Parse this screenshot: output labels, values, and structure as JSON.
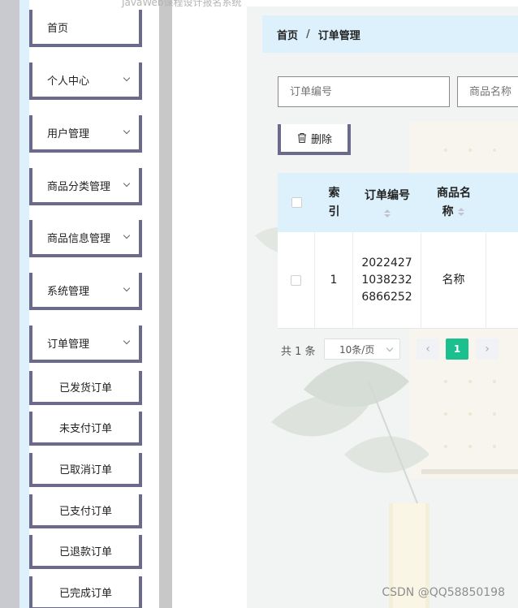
{
  "top_title": "JavaWeb课程设计报名系统",
  "sidebar": {
    "items": [
      {
        "label": "首页",
        "has_children": false
      },
      {
        "label": "个人中心",
        "has_children": true
      },
      {
        "label": "用户管理",
        "has_children": true
      },
      {
        "label": "商品分类管理",
        "has_children": true
      },
      {
        "label": "商品信息管理",
        "has_children": true
      },
      {
        "label": "系统管理",
        "has_children": true
      },
      {
        "label": "订单管理",
        "has_children": true
      }
    ],
    "sub_items": [
      {
        "label": "已发货订单"
      },
      {
        "label": "未支付订单"
      },
      {
        "label": "已取消订单"
      },
      {
        "label": "已支付订单"
      },
      {
        "label": "已退款订单"
      },
      {
        "label": "已完成订单"
      }
    ]
  },
  "breadcrumb": {
    "home": "首页",
    "separator": "/",
    "current": "订单管理"
  },
  "search": {
    "order_no_placeholder": "订单编号",
    "product_name_placeholder": "商品名称"
  },
  "toolbar": {
    "delete_label": "删除"
  },
  "table": {
    "headers": {
      "index": "索引",
      "order_no": "订单编号",
      "product_name": "商品名称"
    },
    "rows": [
      {
        "index": "1",
        "order_no_lines": [
          "2022427",
          "1038232",
          "6866252"
        ],
        "product_name": "名称"
      }
    ]
  },
  "pagination": {
    "total_text": "共 1 条",
    "page_size": "10条/页",
    "current_page": "1",
    "prev": "‹",
    "next": "›"
  },
  "watermark": "CSDN @QQ58850198",
  "colors": {
    "accent_green": "#1cbf8e",
    "header_blue": "#dcf1fc",
    "border_purple": "#6b6a8c",
    "left_strip": "#c9cacf"
  }
}
